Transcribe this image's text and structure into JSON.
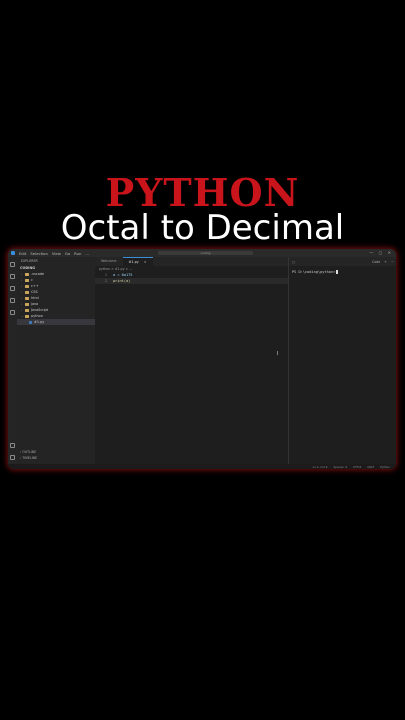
{
  "heading": {
    "line1": "PYTHON",
    "line2": "Octal to Decimal"
  },
  "menubar": {
    "items": [
      "Edit",
      "Selection",
      "View",
      "Go",
      "Run",
      "..."
    ],
    "command_center": "coding"
  },
  "sidebar": {
    "header": "EXPLORER",
    "root": "CODING",
    "items": [
      {
        "label": ".vscode",
        "type": "folder"
      },
      {
        "label": "c",
        "type": "folder"
      },
      {
        "label": "c++",
        "type": "folder"
      },
      {
        "label": "CSS",
        "type": "folder"
      },
      {
        "label": "html",
        "type": "folder"
      },
      {
        "label": "java",
        "type": "folder"
      },
      {
        "label": "JavaScript",
        "type": "folder"
      },
      {
        "label": "python",
        "type": "folder-open"
      },
      {
        "label": "#1.py",
        "type": "file",
        "selected": true
      }
    ],
    "outline": "OUTLINE",
    "timeline": "TIMELINE"
  },
  "editor": {
    "tabs": [
      {
        "label": "Welcome",
        "active": false
      },
      {
        "label": "#1.py",
        "active": true
      }
    ],
    "breadcrumb": "python > #1.py > ...",
    "lines": [
      {
        "num": "1",
        "text": "a = 0o175"
      },
      {
        "num": "2",
        "text": "print(a)"
      }
    ]
  },
  "terminal": {
    "label": "Code",
    "prompt": "PS D:\\coding\\python>"
  },
  "status": {
    "items": [
      "Ln 2, Col 9",
      "Spaces: 4",
      "UTF-8",
      "CRLF",
      "Python"
    ]
  }
}
